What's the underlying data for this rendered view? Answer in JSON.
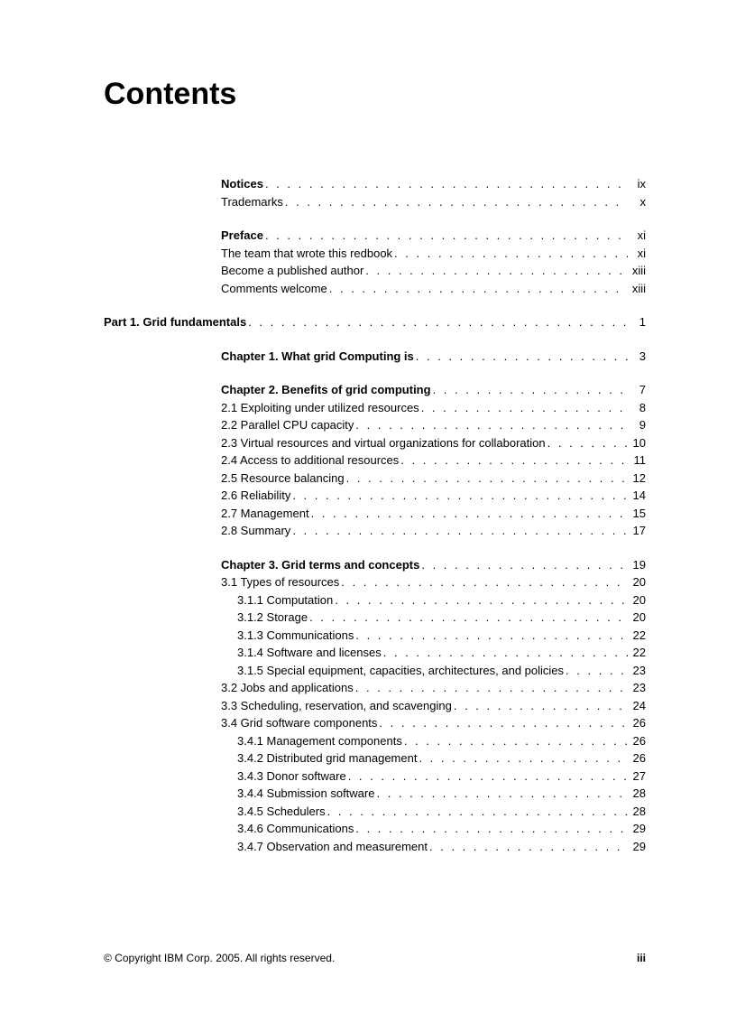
{
  "title": "Contents",
  "groups": [
    [
      {
        "label": "Notices",
        "page": "ix",
        "indent": 1,
        "bold": true
      },
      {
        "label": "Trademarks",
        "page": "x",
        "indent": 1,
        "bold": false
      }
    ],
    [
      {
        "label": "Preface",
        "page": "xi",
        "indent": 1,
        "bold": true
      },
      {
        "label": "The team that wrote this redbook",
        "page": "xi",
        "indent": 1,
        "bold": false
      },
      {
        "label": "Become a published author",
        "page": "xiii",
        "indent": 1,
        "bold": false
      },
      {
        "label": "Comments welcome",
        "page": "xiii",
        "indent": 1,
        "bold": false
      }
    ],
    [
      {
        "label": "Part 1.  Grid fundamentals",
        "page": "1",
        "indent": 0,
        "bold": true
      }
    ],
    [
      {
        "label": "Chapter 1.  What grid Computing is",
        "page": "3",
        "indent": 1,
        "bold": true
      }
    ],
    [
      {
        "label": "Chapter 2.  Benefits of grid computing",
        "page": "7",
        "indent": 1,
        "bold": true
      },
      {
        "label": "2.1  Exploiting under utilized resources",
        "page": "8",
        "indent": 1,
        "bold": false
      },
      {
        "label": "2.2  Parallel CPU capacity",
        "page": "9",
        "indent": 1,
        "bold": false
      },
      {
        "label": "2.3  Virtual resources and virtual organizations for collaboration",
        "page": "10",
        "indent": 1,
        "bold": false
      },
      {
        "label": "2.4  Access to additional resources",
        "page": "11",
        "indent": 1,
        "bold": false
      },
      {
        "label": "2.5  Resource balancing",
        "page": "12",
        "indent": 1,
        "bold": false
      },
      {
        "label": "2.6  Reliability",
        "page": "14",
        "indent": 1,
        "bold": false
      },
      {
        "label": "2.7  Management",
        "page": "15",
        "indent": 1,
        "bold": false
      },
      {
        "label": "2.8  Summary",
        "page": "17",
        "indent": 1,
        "bold": false
      }
    ],
    [
      {
        "label": "Chapter 3.  Grid terms and concepts",
        "page": "19",
        "indent": 1,
        "bold": true
      },
      {
        "label": "3.1  Types of resources",
        "page": "20",
        "indent": 1,
        "bold": false
      },
      {
        "label": "3.1.1  Computation",
        "page": "20",
        "indent": 2,
        "bold": false
      },
      {
        "label": "3.1.2  Storage",
        "page": "20",
        "indent": 2,
        "bold": false
      },
      {
        "label": "3.1.3  Communications",
        "page": "22",
        "indent": 2,
        "bold": false
      },
      {
        "label": "3.1.4  Software and licenses",
        "page": "22",
        "indent": 2,
        "bold": false
      },
      {
        "label": "3.1.5  Special equipment, capacities, architectures, and policies",
        "page": "23",
        "indent": 2,
        "bold": false
      },
      {
        "label": "3.2  Jobs and applications",
        "page": "23",
        "indent": 1,
        "bold": false
      },
      {
        "label": "3.3  Scheduling, reservation, and scavenging",
        "page": "24",
        "indent": 1,
        "bold": false
      },
      {
        "label": "3.4  Grid software components",
        "page": "26",
        "indent": 1,
        "bold": false
      },
      {
        "label": "3.4.1  Management components",
        "page": "26",
        "indent": 2,
        "bold": false
      },
      {
        "label": "3.4.2  Distributed grid management",
        "page": "26",
        "indent": 2,
        "bold": false
      },
      {
        "label": "3.4.3  Donor software",
        "page": "27",
        "indent": 2,
        "bold": false
      },
      {
        "label": "3.4.4  Submission software",
        "page": "28",
        "indent": 2,
        "bold": false
      },
      {
        "label": "3.4.5  Schedulers",
        "page": "28",
        "indent": 2,
        "bold": false
      },
      {
        "label": "3.4.6  Communications",
        "page": "29",
        "indent": 2,
        "bold": false
      },
      {
        "label": "3.4.7  Observation and measurement",
        "page": "29",
        "indent": 2,
        "bold": false
      }
    ]
  ],
  "footer": {
    "copyright": "© Copyright IBM Corp. 2005. All rights reserved.",
    "pageNumber": "iii"
  }
}
